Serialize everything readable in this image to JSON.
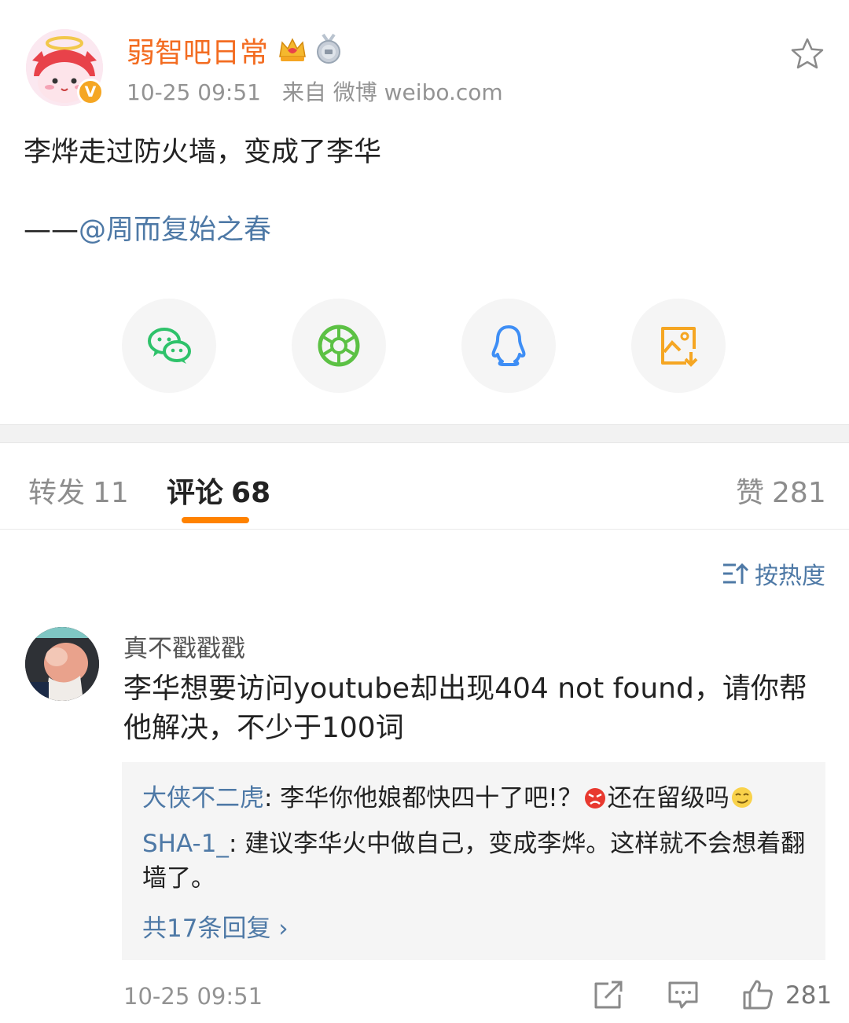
{
  "post": {
    "username": "弱智吧日常",
    "timestamp": "10-25 09:51",
    "source": "来自 微博 weibo.com",
    "text": "李烨走过防火墙，变成了李华",
    "sign_prefix": "——",
    "mention": "@周而复始之春",
    "badges": [
      "crown-badge",
      "medal-badge"
    ]
  },
  "share": [
    {
      "icon": "wechat-icon",
      "color": "#2ec26a"
    },
    {
      "icon": "moments-icon",
      "color": "#5cc144"
    },
    {
      "icon": "qq-icon",
      "color": "#3e8ef5"
    },
    {
      "icon": "save-image-icon",
      "color": "#f5a623"
    }
  ],
  "tabs": {
    "repost_label": "转发",
    "repost_count": "11",
    "comment_label": "评论",
    "comment_count": "68",
    "like_label": "赞",
    "like_count": "281"
  },
  "sort_label": "按热度",
  "comment": {
    "author": "真不戳戳戳",
    "text": "李华想要访问youtube却出现404 not found，请你帮他解决，不少于100词",
    "replies": [
      {
        "author": "大侠不二虎",
        "text_a": ": 李华你他娘都快四十了吧!？",
        "text_b": "还在留级吗"
      },
      {
        "author": "SHA-1_",
        "text": ": 建议李华火中做自己，变成李烨。这样就不会想着翻墙了。"
      }
    ],
    "more_replies": "共17条回复 ›",
    "timestamp": "10-25 09:51",
    "likes": "281"
  },
  "colors": {
    "accent": "#ff8200",
    "username": "#f36c21",
    "link": "#4e79a6"
  }
}
